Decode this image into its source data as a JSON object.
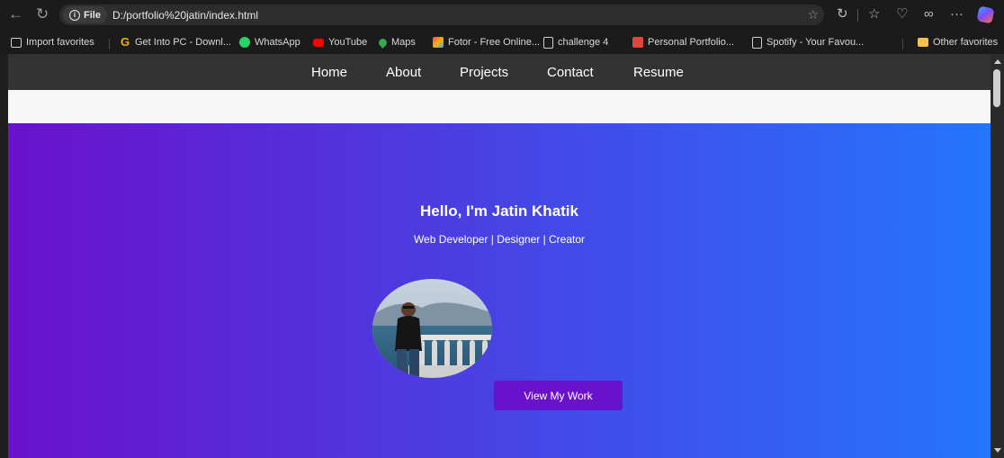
{
  "browser": {
    "site_label": "File",
    "url": "D:/portfolio%20jatin/index.html",
    "nav_icons": [
      "back-icon",
      "refresh-icon"
    ],
    "toolbar_icons": [
      "favorite-star-icon",
      "refresh-extension-icon",
      "favorites-icon",
      "browser-essentials-icon",
      "share-icon",
      "more-icon",
      "copilot-icon"
    ],
    "more_label": "···"
  },
  "bookmarks": [
    {
      "label": "Import favorites",
      "icon": "import-icon"
    },
    {
      "label": "Get Into PC - Downl...",
      "icon": "g-icon",
      "color": "#f0b400"
    },
    {
      "label": "WhatsApp",
      "icon": "whatsapp-icon",
      "color": "#25d366"
    },
    {
      "label": "YouTube",
      "icon": "youtube-icon",
      "color": "#ff0000"
    },
    {
      "label": "Maps",
      "icon": "maps-icon",
      "color": "#34a853"
    },
    {
      "label": "Fotor - Free Online...",
      "icon": "fotor-icon",
      "color": "#ff7a00"
    },
    {
      "label": "challenge 4",
      "icon": "page-icon"
    },
    {
      "label": "Personal Portfolio...",
      "icon": "portfolio-icon",
      "color": "#e0463f"
    },
    {
      "label": "Spotify - Your Favou...",
      "icon": "page-icon"
    },
    {
      "label": "Other favorites",
      "icon": "folder-icon",
      "color": "#f2c14e"
    }
  ],
  "site": {
    "nav": [
      "Home",
      "About",
      "Projects",
      "Contact",
      "Resume"
    ],
    "hero": {
      "title": "Hello, I'm Jatin Khatik",
      "subtitle": "Web Developer | Designer | Creator",
      "cta": "View My Work",
      "avatar_alt": "profile photo"
    },
    "colors": {
      "nav_bg": "#333333",
      "gradient_start": "#6a11cb",
      "gradient_end": "#2575fc",
      "button_bg": "#6a11cb"
    }
  }
}
